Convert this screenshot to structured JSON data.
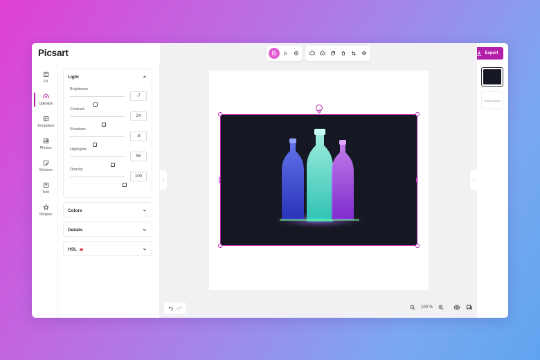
{
  "app": {
    "logo": "Picsart"
  },
  "header": {
    "export_label": "Export"
  },
  "rail": {
    "items": [
      {
        "label": "Fit",
        "icon": "fit-icon"
      },
      {
        "label": "Uploads",
        "icon": "upload-icon",
        "active": true
      },
      {
        "label": "Templates",
        "icon": "templates-icon"
      },
      {
        "label": "Photos",
        "icon": "photos-icon"
      },
      {
        "label": "Stickers",
        "icon": "stickers-icon"
      },
      {
        "label": "Text",
        "icon": "text-icon"
      },
      {
        "label": "Shapes",
        "icon": "star-icon"
      }
    ]
  },
  "adjust": {
    "light": {
      "title": "Light",
      "sliders": [
        {
          "label": "Brightness",
          "value": "-7",
          "level": -7,
          "min": -100,
          "max": 100
        },
        {
          "label": "Contrast",
          "value": "24",
          "level": 24,
          "min": -100,
          "max": 100
        },
        {
          "label": "Shadows",
          "value": "-8",
          "level": -8,
          "min": -100,
          "max": 100
        },
        {
          "label": "Highlights",
          "value": "58",
          "level": 58,
          "min": -100,
          "max": 100
        },
        {
          "label": "Opacity",
          "value": "100",
          "level": 100,
          "min": 0,
          "max": 100
        }
      ]
    },
    "colors_title": "Colors",
    "details_title": "Details",
    "hsl_title": "HSL"
  },
  "toolbar": {
    "tools": [
      "adjust-icon",
      "fx-icon",
      "effects-icon",
      "cloud-icon",
      "layers-icon",
      "duplicate-icon",
      "delete-icon",
      "crop-icon",
      "more-icon"
    ],
    "fx_label": "fx"
  },
  "canvas": {
    "zoom": "100 %",
    "accent": "#b31fa8",
    "photo_bg": "#151722"
  },
  "pages": {
    "add_label": "1080x1080px"
  }
}
